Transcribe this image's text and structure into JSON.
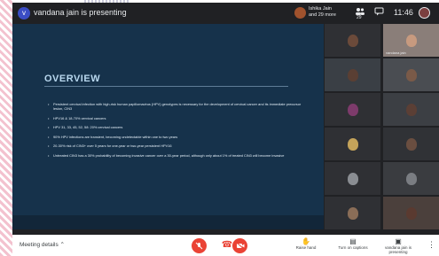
{
  "topbar": {
    "presenter_initial": "v",
    "presenter_text": "vandana jain is presenting",
    "hand_raise_text": "Ishika Jain and 29 more",
    "participants_icon": "people-icon",
    "participants_count": "29",
    "chat_icon": "chat-icon",
    "time": "11:46"
  },
  "slide": {
    "title": "OVERVIEW",
    "bullets": [
      "Persistent cervical infection with high-risk human papillomavirus (HPV) genotypes is necessary for the development of cervical cancer and its immediate precursor lesion, CIN3",
      "HPV16 & 18-70% cervical cancers",
      "HPV 31, 33, 45, 52, 58: 20% cervical cancers",
      "90% HPV infections are transient, becoming undetectable within one to two years",
      "20-30% risk of CIN3+ over 5 years for one-year or two-year persistent HPV16",
      "Untreated CIN3 has a 30% probability of becoming invasive cancer over a 30-year period, although only about 1% of treated CIN3 will become invasive"
    ]
  },
  "grid": {
    "tiles": [
      {
        "name": "",
        "bg": "#2f3034",
        "face": "#6b4a3a"
      },
      {
        "name": "vandana jain",
        "bg": "#8a7e79",
        "face": "#c79a7f"
      },
      {
        "name": "",
        "bg": "#3a3f45",
        "face": "#5a3f33"
      },
      {
        "name": "",
        "bg": "#4a4d52",
        "face": "#7a5a48"
      },
      {
        "name": "",
        "bg": "#2f3034",
        "face": "#7d3b6b"
      },
      {
        "name": "",
        "bg": "#3c3f44",
        "face": "#5b3f35"
      },
      {
        "name": "",
        "bg": "#2f3034",
        "face": "#c4a35a"
      },
      {
        "name": "",
        "bg": "#303236",
        "face": "#6a4e40"
      },
      {
        "name": "",
        "bg": "#2f3034",
        "face": "#8a8d92"
      },
      {
        "name": "",
        "bg": "#3a3c40",
        "face": "#7a7d82"
      },
      {
        "name": "",
        "bg": "#2f3034",
        "face": "#8a6d57"
      },
      {
        "name": "",
        "bg": "#4b403c",
        "face": "#5a3a30"
      }
    ]
  },
  "controls": {
    "meeting_details": "Meeting details",
    "mic_icon": "mic-off-icon",
    "end_icon": "end-call-icon",
    "cam_icon": "camera-off-icon",
    "raise_hand_label": "Raise hand",
    "captions_label": "Turn on captions",
    "presenting_label": "vandana jain is presenting"
  }
}
